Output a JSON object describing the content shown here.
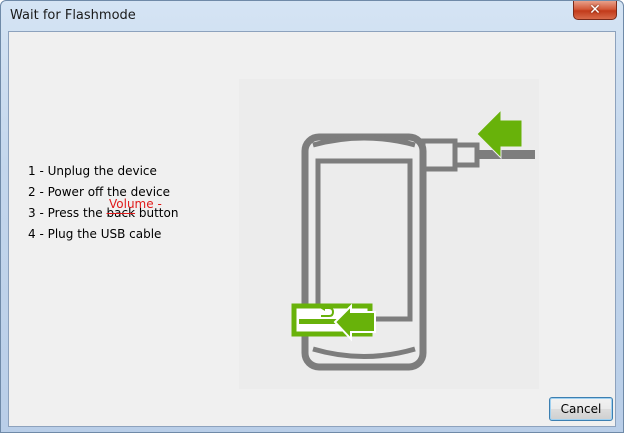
{
  "window": {
    "title": "Wait for Flashmode",
    "close_glyph": "✕"
  },
  "steps": [
    {
      "text": "1 - Unplug the device"
    },
    {
      "text": "2 - Power off the device"
    },
    {
      "prefix": "3 - Press the ",
      "struck": "back",
      "suffix": " button",
      "annotation": "Volume -"
    },
    {
      "text": "4 - Plug the USB cable"
    }
  ],
  "illustration": {
    "icons": [
      "phone-icon",
      "usb-cable-icon",
      "arrow-left-icon",
      "back-key-icon"
    ],
    "colors": {
      "phone": "#7d7d7d",
      "arrow": "#68b20a",
      "background": "#ececec"
    }
  },
  "buttons": {
    "cancel_label": "Cancel"
  },
  "colors": {
    "annotation": "#e01a1a",
    "client_bg": "#f0f0f0"
  }
}
